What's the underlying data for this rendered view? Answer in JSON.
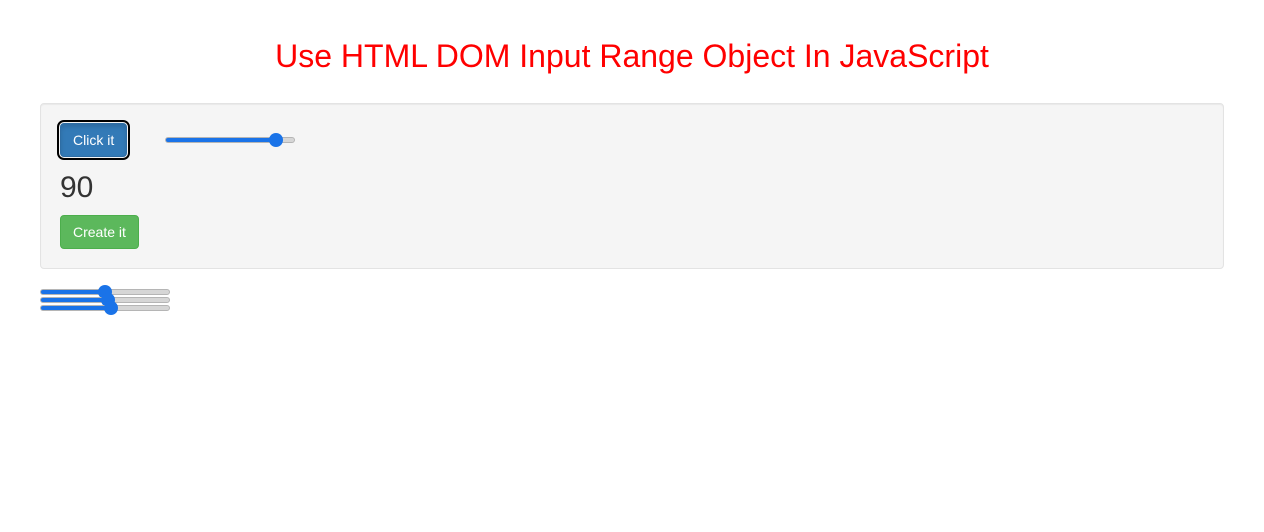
{
  "page": {
    "title": "Use HTML DOM Input Range Object In JavaScript"
  },
  "well": {
    "click_button_label": "Click it",
    "main_slider_value": "90",
    "output_value": "90",
    "create_button_label": "Create it"
  },
  "extra_sliders": {
    "slider1_value": "50",
    "slider2_value": "53",
    "slider3_value": "55"
  }
}
